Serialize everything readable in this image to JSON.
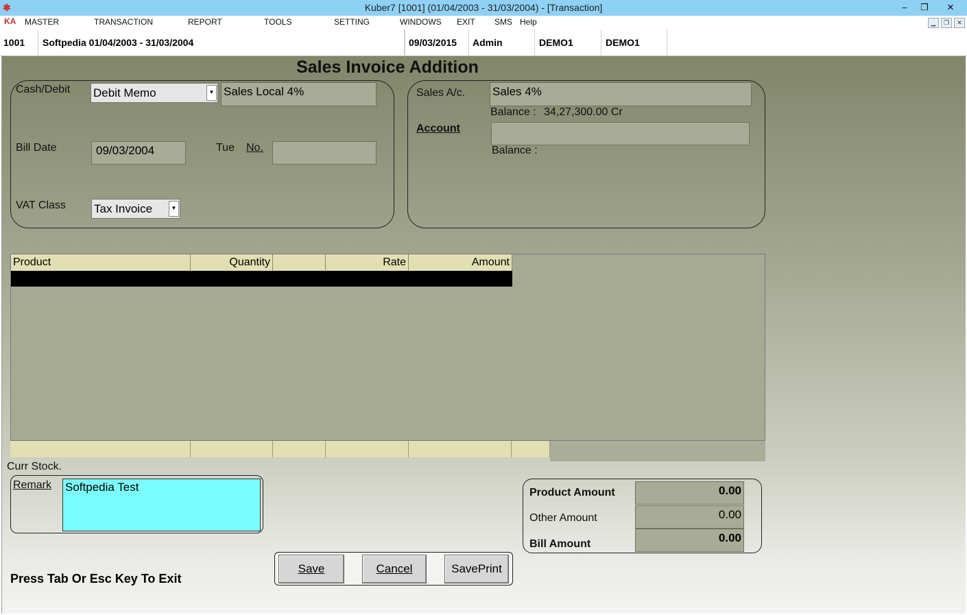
{
  "window": {
    "title": "Kuber7 [1001] (01/04/2003 - 31/03/2004) - [Transaction]",
    "minimize": "–",
    "restore": "❒",
    "close": "✕"
  },
  "menu": [
    "MASTER",
    "TRANSACTION",
    "REPORT",
    "TOOLS",
    "SETTING",
    "WINDOWS",
    "EXIT",
    "SMS",
    "Help"
  ],
  "info": {
    "code": "1001",
    "company": "Softpedia  01/04/2003 - 31/03/2004",
    "date": "09/03/2015",
    "user": "Admin",
    "db1": "DEMO1",
    "db2": "DEMO1"
  },
  "form": {
    "title": "Sales Invoice Addition",
    "cash_debit_label": "Cash/Debit",
    "cash_debit_value": "Debit Memo",
    "sales_local": "Sales Local 4%",
    "bill_date_label": "Bill Date",
    "bill_date_value": "09/03/2004",
    "day": "Tue",
    "no_label": "No.",
    "no_value": "",
    "vat_class_label": "VAT Class",
    "vat_class_value": "Tax Invoice",
    "sales_ac_label": "Sales A/c.",
    "sales_ac_value": "Sales 4%",
    "balance_label": "Balance :",
    "balance_value": "34,27,300.00  Cr",
    "account_label": "Account",
    "account_value": "",
    "balance2_label": "Balance :"
  },
  "grid": {
    "headers": [
      "Product",
      "Quantity",
      "",
      "Rate",
      "Amount"
    ]
  },
  "bottom": {
    "curr_stock": "Curr Stock.",
    "remark_label": "Remark",
    "remark_value": "Softpedia Test",
    "product_amount_label": "Product Amount",
    "product_amount": "0.00",
    "other_amount_label": "Other Amount",
    "other_amount": "0.00",
    "bill_amount_label": "Bill Amount",
    "bill_amount": "0.00",
    "hint": "Press Tab Or Esc Key To Exit"
  },
  "buttons": {
    "save": "Save",
    "cancel": "Cancel",
    "saveprint": "SavePrint"
  }
}
